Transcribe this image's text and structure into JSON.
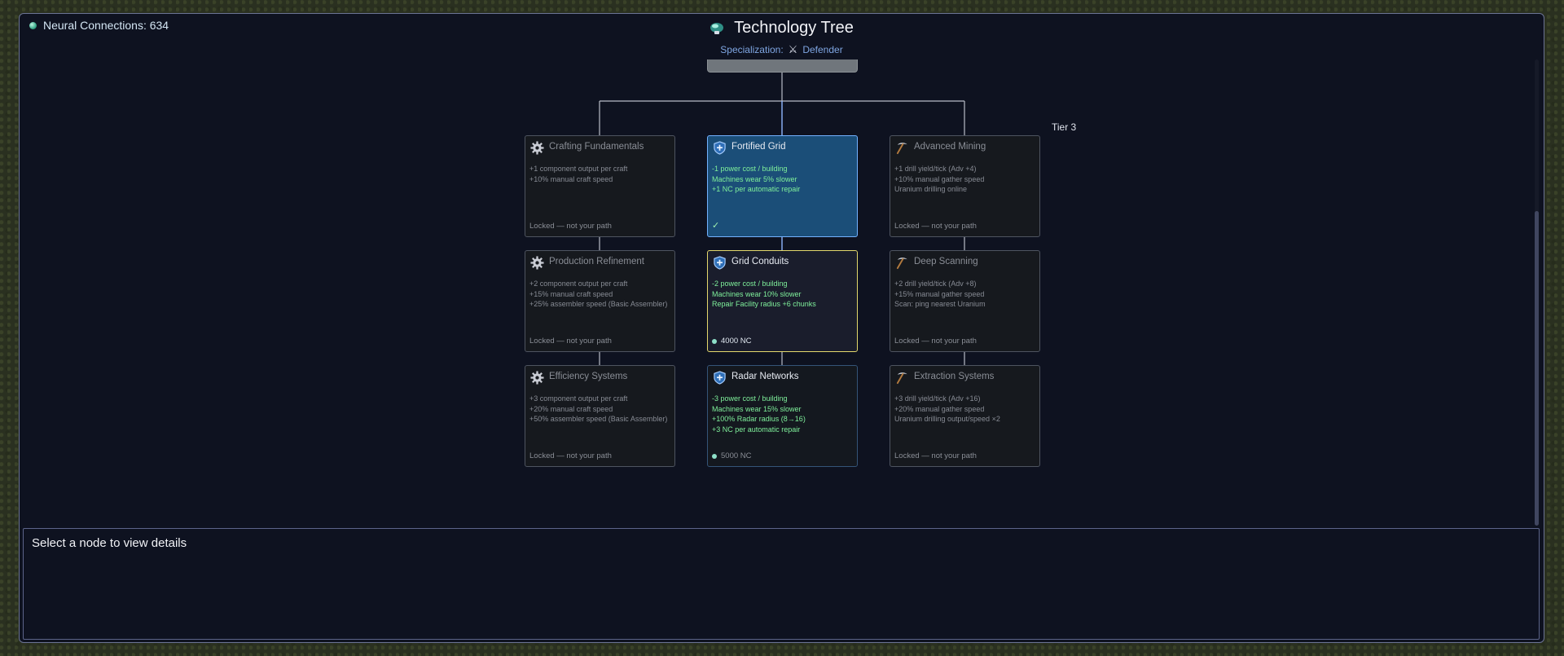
{
  "resources": {
    "neural_connections_label": "Neural Connections: 634"
  },
  "header": {
    "title": "Technology Tree",
    "specialization_label": "Specialization:",
    "specialization_value": "Defender"
  },
  "tier_label": "Tier 3",
  "columns": {
    "crafting": [
      {
        "title": "Crafting Fundamentals",
        "effects": [
          "+1 component output per craft",
          "+10% manual craft speed"
        ],
        "footer": "Locked — not your path"
      },
      {
        "title": "Production Refinement",
        "effects": [
          "+2 component output per craft",
          "+15% manual craft speed",
          "+25% assembler speed (Basic Assembler)"
        ],
        "footer": "Locked — not your path"
      },
      {
        "title": "Efficiency Systems",
        "effects": [
          "+3 component output per craft",
          "+20% manual craft speed",
          "+50% assembler speed (Basic Assembler)"
        ],
        "footer": "Locked — not your path"
      }
    ],
    "defender": [
      {
        "title": "Fortified Grid",
        "effects": [
          "-1 power cost / building",
          "Machines wear 5% slower",
          "+1 NC per automatic repair"
        ],
        "footer": "✓"
      },
      {
        "title": "Grid Conduits",
        "effects": [
          "-2 power cost / building",
          "Machines wear 10% slower",
          "Repair Facility radius +6 chunks"
        ],
        "footer": "4000 NC"
      },
      {
        "title": "Radar Networks",
        "effects": [
          "-3 power cost / building",
          "Machines wear 15% slower",
          "+100% Radar radius (8→16)",
          "+3 NC per automatic repair"
        ],
        "footer": "5000 NC"
      }
    ],
    "mining": [
      {
        "title": "Advanced Mining",
        "effects": [
          "+1 drill yield/tick (Adv +4)",
          "+10% manual gather speed",
          "Uranium drilling online"
        ],
        "footer": "Locked — not your path"
      },
      {
        "title": "Deep Scanning",
        "effects": [
          "+2 drill yield/tick (Adv +8)",
          "+15% manual gather speed",
          "Scan: ping nearest Uranium"
        ],
        "footer": "Locked — not your path"
      },
      {
        "title": "Extraction Systems",
        "effects": [
          "+3 drill yield/tick (Adv +16)",
          "+20% manual gather speed",
          "Uranium drilling output/speed ×2"
        ],
        "footer": "Locked — not your path"
      }
    ]
  },
  "details": {
    "placeholder": "Select a node to view details"
  },
  "colors": {
    "unlocked_border": "#73b2ff",
    "selected_border": "#e3d86c",
    "effect_green": "#7ff09b",
    "panel_bg": "#0e1220"
  }
}
